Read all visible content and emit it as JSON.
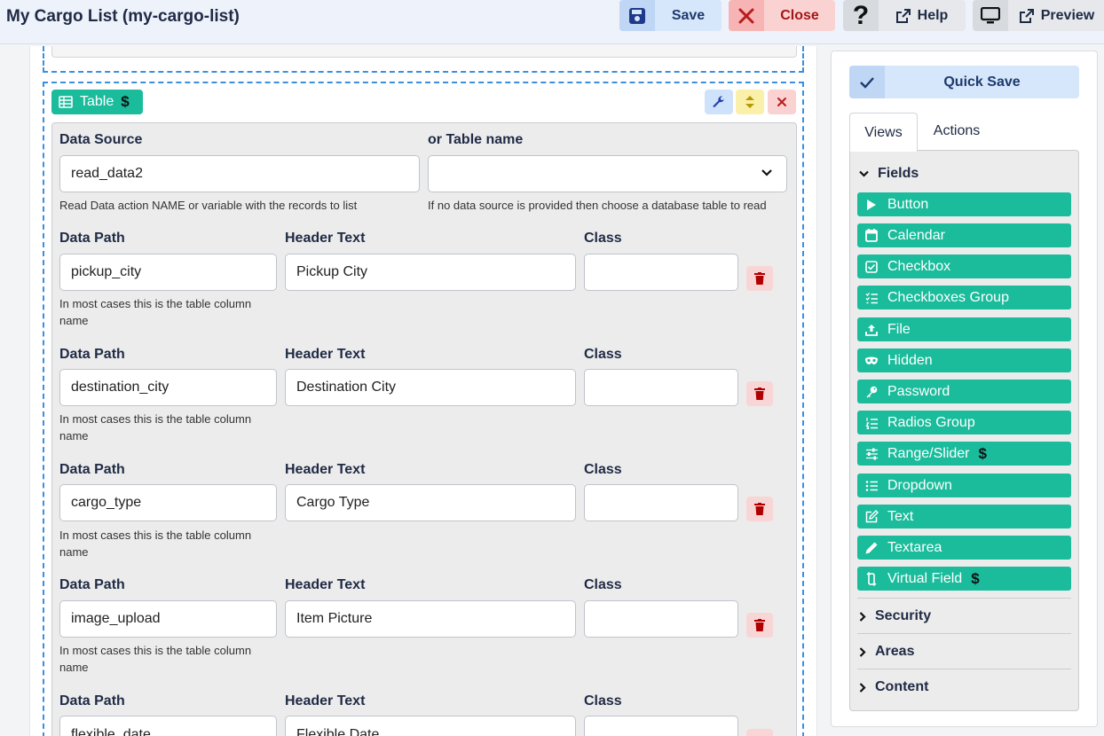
{
  "app": {
    "title": "My Cargo List (my-cargo-list)"
  },
  "header": {
    "save_label": "Save",
    "close_label": "Close",
    "help_icon_text": "?",
    "help_label": "Help",
    "preview_label": "Preview"
  },
  "table_block": {
    "tag_label": "Table",
    "tag_badge": "$",
    "data_source_label": "Data Source",
    "data_source_value": "read_data2",
    "data_source_help": "Read Data action NAME or variable with the records to list",
    "table_name_label": "or Table name",
    "table_name_value": "",
    "table_name_help": "If no data source is provided then choose a database table to read"
  },
  "columns": [
    {
      "data_path_label": "Data Path",
      "header_label": "Header Text",
      "class_label": "Class",
      "data_path": "pickup_city",
      "header_text": "Pickup City",
      "class_value": "",
      "help_line1": "In most cases this is the table column",
      "help_line2": "name"
    },
    {
      "data_path_label": "Data Path",
      "header_label": "Header Text",
      "class_label": "Class",
      "data_path": "destination_city",
      "header_text": "Destination City",
      "class_value": "",
      "help_line1": "In most cases this is the table column",
      "help_line2": "name"
    },
    {
      "data_path_label": "Data Path",
      "header_label": "Header Text",
      "class_label": "Class",
      "data_path": "cargo_type",
      "header_text": "Cargo Type",
      "class_value": "",
      "help_line1": "In most cases this is the table column",
      "help_line2": "name"
    },
    {
      "data_path_label": "Data Path",
      "header_label": "Header Text",
      "class_label": "Class",
      "data_path": "image_upload",
      "header_text": "Item Picture",
      "class_value": "",
      "help_line1": "In most cases this is the table column",
      "help_line2": "name"
    },
    {
      "data_path_label": "Data Path",
      "header_label": "Header Text",
      "class_label": "Class",
      "data_path": "flexible_date",
      "header_text": "Flexible Date",
      "class_value": "",
      "help_line1": "",
      "help_line2": ""
    }
  ],
  "sidebar": {
    "quick_save_label": "Quick Save",
    "tabs": {
      "views": "Views",
      "actions": "Actions"
    },
    "fields_label": "Fields",
    "fields": [
      {
        "label": "Button",
        "icon": "play-icon"
      },
      {
        "label": "Calendar",
        "icon": "calendar-icon"
      },
      {
        "label": "Checkbox",
        "icon": "checkbox-icon"
      },
      {
        "label": "Checkboxes Group",
        "icon": "checklist-icon"
      },
      {
        "label": "File",
        "icon": "upload-icon"
      },
      {
        "label": "Hidden",
        "icon": "mask-icon"
      },
      {
        "label": "Password",
        "icon": "key-icon"
      },
      {
        "label": "Radios Group",
        "icon": "numbered-list-icon"
      },
      {
        "label": "Range/Slider",
        "icon": "sliders-icon",
        "badge": "$"
      },
      {
        "label": "Dropdown",
        "icon": "list-icon"
      },
      {
        "label": "Text",
        "icon": "edit-icon"
      },
      {
        "label": "Textarea",
        "icon": "pencil-icon"
      },
      {
        "label": "Virtual Field",
        "icon": "repeat-icon",
        "badge": "$"
      }
    ],
    "sections": {
      "security": "Security",
      "areas": "Areas",
      "content": "Content"
    }
  },
  "colors": {
    "accent_teal": "#1abc9c",
    "dashed_blue": "#3a8fe0",
    "save_blue": "#d6e6fb",
    "close_red": "#fbd2d2"
  }
}
